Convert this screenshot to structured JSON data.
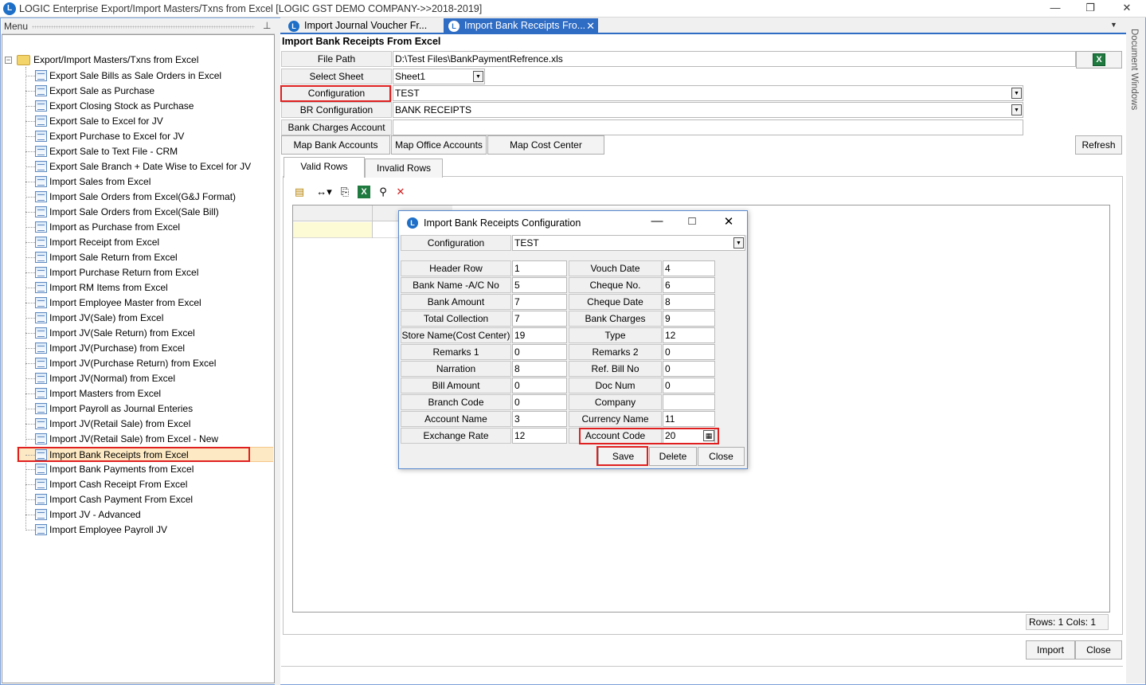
{
  "window": {
    "title": "LOGIC Enterprise   Export/Import Masters/Txns from Excel  [LOGIC GST DEMO COMPANY->>2018-2019]",
    "logo_letter": "L",
    "minimize": "—",
    "restore": "❐",
    "close": "✕"
  },
  "menu": {
    "header": "Menu",
    "pin_icon": "⊥",
    "root": {
      "toggle": "−",
      "label": "Export/Import Masters/Txns from Excel"
    },
    "items": [
      "Export Sale Bills as Sale Orders in Excel",
      "Export Sale as Purchase",
      "Export Closing Stock as Purchase",
      "Export Sale to Excel for JV",
      "Export Purchase to Excel for JV",
      "Export Sale to Text File - CRM",
      "Export Sale Branch + Date Wise to Excel for JV",
      "Import Sales from Excel",
      "Import Sale Orders from Excel(G&J Format)",
      "Import Sale Orders from Excel(Sale Bill)",
      "Import as Purchase from Excel",
      "Import Receipt from Excel",
      "Import Sale Return from Excel",
      "Import Purchase Return from Excel",
      "Import RM Items from Excel",
      "Import Employee Master from Excel",
      "Import JV(Sale) from Excel",
      "Import JV(Sale Return) from Excel",
      "Import JV(Purchase) from Excel",
      "Import JV(Purchase Return) from Excel",
      "Import JV(Normal) from Excel",
      "Import Masters from Excel",
      "Import Payroll as Journal Enteries",
      "Import JV(Retail Sale) from Excel",
      "Import JV(Retail Sale) from Excel - New",
      "Import Bank Receipts from Excel",
      "Import Bank Payments from Excel",
      "Import Cash Receipt From Excel",
      "Import Cash Payment From Excel",
      "Import JV - Advanced",
      "Import Employee Payroll JV"
    ],
    "selected_index": 25
  },
  "tabs": [
    {
      "label": "Import Journal Voucher Fr...",
      "active": false
    },
    {
      "label": "Import Bank Receipts Fro...",
      "active": true,
      "close": "✕"
    }
  ],
  "tab_dropdown": "▼",
  "document_windows_label": "Document Windows",
  "page": {
    "title": "Import Bank Receipts From Excel",
    "file_path_label": "File Path",
    "file_path_value": "D:\\Test Files\\BankPaymentRefrence.xls",
    "select_sheet_label": "Select Sheet",
    "select_sheet_value": "Sheet1",
    "configuration_label": "Configuration",
    "configuration_value": "TEST",
    "br_configuration_label": "BR Configuration",
    "br_configuration_value": "BANK RECEIPTS",
    "bank_charges_label": "Bank Charges Account",
    "bank_charges_value": "",
    "buttons": {
      "map_bank_accounts": "Map Bank Accounts",
      "map_office_accounts": "Map Office Accounts",
      "map_cost_center": "Map Cost Center",
      "refresh": "Refresh",
      "import": "Import",
      "close": "Close"
    },
    "sub_tabs": [
      "Valid Rows",
      "Invalid Rows"
    ],
    "status": "Rows: 1   Cols: 1"
  },
  "dialog": {
    "title": "Import Bank Receipts Configuration",
    "configuration_label": "Configuration",
    "configuration_value": "TEST",
    "left_fields": [
      {
        "label": "Header Row",
        "value": "1"
      },
      {
        "label": "Bank Name -A/C No",
        "value": "5"
      },
      {
        "label": "Bank Amount",
        "value": "7"
      },
      {
        "label": "Total Collection",
        "value": "7"
      },
      {
        "label": "Store Name(Cost Center)",
        "value": "19"
      },
      {
        "label": "Remarks 1",
        "value": "0"
      },
      {
        "label": "Narration",
        "value": "8"
      },
      {
        "label": "Bill Amount",
        "value": "0"
      },
      {
        "label": "Branch Code",
        "value": "0"
      },
      {
        "label": "Account Name",
        "value": "3"
      },
      {
        "label": "Exchange Rate",
        "value": "12"
      }
    ],
    "right_fields": [
      {
        "label": "Vouch Date",
        "value": "4"
      },
      {
        "label": "Cheque No.",
        "value": "6"
      },
      {
        "label": "Cheque Date",
        "value": "8"
      },
      {
        "label": "Bank Charges",
        "value": "9"
      },
      {
        "label": "Type",
        "value": "12"
      },
      {
        "label": "Remarks 2",
        "value": "0"
      },
      {
        "label": "Ref. Bill No",
        "value": "0"
      },
      {
        "label": "Doc Num",
        "value": "0"
      },
      {
        "label": "Company",
        "value": ""
      },
      {
        "label": "Currency Name",
        "value": "11"
      },
      {
        "label": "Account Code",
        "value": "20"
      }
    ],
    "buttons": {
      "save": "Save",
      "delete": "Delete",
      "close": "Close"
    }
  },
  "colors": {
    "accent": "#2f6cc4",
    "highlight_red": "#e02020",
    "selected_row": "#fde9c3"
  }
}
